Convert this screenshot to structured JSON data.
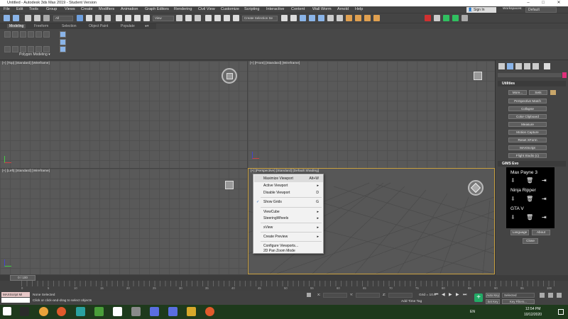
{
  "app": {
    "title": "Untitled - Autodesk 3ds Max 2019 - Student Version"
  },
  "menu": [
    "File",
    "Edit",
    "Tools",
    "Group",
    "Views",
    "Create",
    "Modifiers",
    "Animation",
    "Graph Editors",
    "Rendering",
    "Civil View",
    "Customize",
    "Scripting",
    "Interactive",
    "Content",
    "Wall Worm",
    "Arnold",
    "Help"
  ],
  "account": {
    "sign_in": "Sign In",
    "workspaces_label": "Workspaces:",
    "workspace": "Default"
  },
  "toolbar": {
    "filter": "All",
    "refcoord": "View",
    "selset": "Create Selection Se"
  },
  "ribbon": {
    "tabs": [
      "Modeling",
      "Freeform",
      "Selection",
      "Object Paint",
      "Populate"
    ],
    "panel_label": "Polygon Modeling"
  },
  "viewports": {
    "top": "[+] [Top] [Standard] [Wireframe]",
    "front": "[+] [Front] [Standard] [Wireframe]",
    "left": "[+] [Left] [Standard] [Wireframe]",
    "perspective": "[+] [Perspective] [Standard] [Default Shading]"
  },
  "context_menu": {
    "items": [
      {
        "label": "Maximize Viewport",
        "shortcut": "Alt+W"
      },
      {
        "label": "Active Viewport",
        "shortcut": "▸"
      },
      {
        "label": "Disable Viewport",
        "shortcut": "D"
      },
      {
        "label": "Show Grids",
        "shortcut": "G",
        "checked": true
      },
      {
        "label": "ViewCube",
        "shortcut": "▸"
      },
      {
        "label": "SteeringWheels",
        "shortcut": "▸"
      },
      {
        "label": "xView",
        "shortcut": "▸"
      },
      {
        "label": "Create Preview",
        "shortcut": "▸"
      },
      {
        "label": "Configure Viewports...",
        "shortcut": ""
      },
      {
        "label": "2D Pan Zoom Mode",
        "shortcut": ""
      }
    ],
    "check": "✓"
  },
  "utilities": {
    "header": "Utilities",
    "more": "More...",
    "sets": "Sets",
    "buttons": [
      "Perspective Match",
      "Collapse",
      "Color Clipboard",
      "Measure",
      "Motion Capture",
      "Reset XForm",
      "MAXScript",
      "Flight Studio (c)"
    ]
  },
  "gims": {
    "header": "GIMS Evo",
    "games": [
      "Max Payne 3",
      "Ninja Ripper",
      "GTA V"
    ],
    "language": "Language",
    "about": "About",
    "close": "Close"
  },
  "timeline": {
    "frame": "0 / 100",
    "ticks": [
      "0",
      "5",
      "10",
      "15",
      "20",
      "25",
      "30",
      "35",
      "40",
      "45",
      "50",
      "55",
      "60",
      "65",
      "70",
      "75",
      "80",
      "85",
      "90",
      "95",
      "100"
    ]
  },
  "status": {
    "maxscript": "MAXScript Mi",
    "selection": "None Selected",
    "prompt": "Click or click-and-drag to select objects",
    "x_label": "X:",
    "y_label": "Y:",
    "z_label": "Z:",
    "grid": "Grid = 10.0",
    "add_time_tag": "Add Time Tag",
    "auto_key": "Auto Key",
    "set_key": "Set Key",
    "key_mode": "Selected",
    "key_filters": "Key Filters..."
  },
  "taskbar": {
    "lang": "EN",
    "time": "12:54 PM",
    "date": "10/12/2020"
  },
  "colors": {
    "accent": "#c8a040",
    "menu_bg": "#f2f2f2",
    "gims_bg": "#000000",
    "taskbar": "#1e3a1c"
  }
}
